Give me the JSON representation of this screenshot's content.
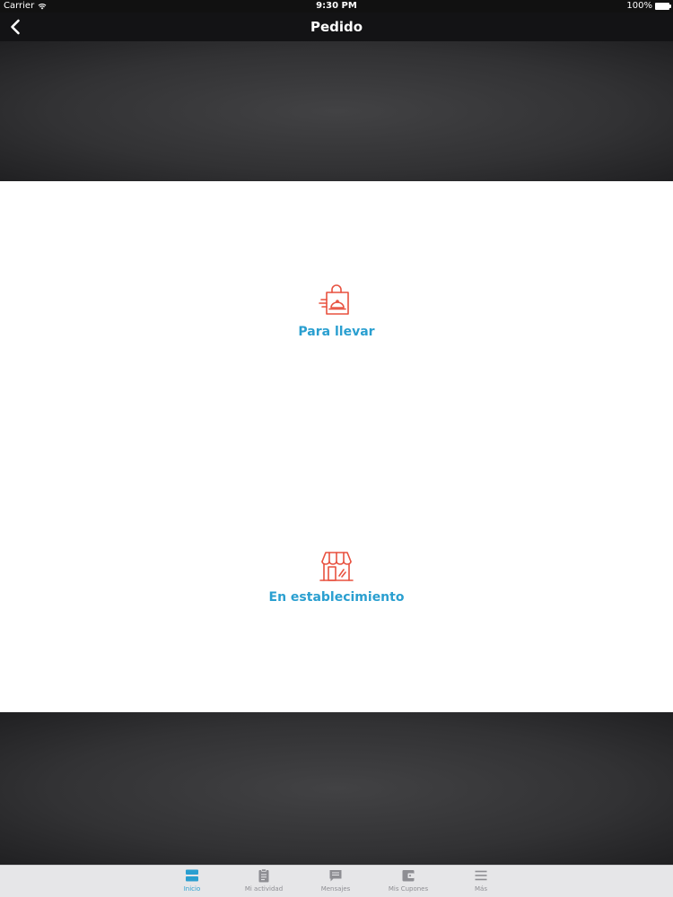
{
  "status_bar": {
    "carrier": "Carrier",
    "time": "9:30 PM",
    "battery": "100%"
  },
  "nav": {
    "title": "Pedido"
  },
  "options": {
    "takeaway_label": "Para llevar",
    "dinein_label": "En establecimiento"
  },
  "tabs": [
    {
      "label": "Inicio",
      "icon": "home-icon",
      "active": true
    },
    {
      "label": "Mi actividad",
      "icon": "clipboard-icon",
      "active": false
    },
    {
      "label": "Mensajes",
      "icon": "chat-icon",
      "active": false
    },
    {
      "label": "Mis Cupones",
      "icon": "wallet-icon",
      "active": false
    },
    {
      "label": "Más",
      "icon": "menu-icon",
      "active": false
    }
  ],
  "colors": {
    "accent": "#2a9fd0",
    "icon_red": "#e8513f",
    "tab_inactive": "#8e8e93"
  }
}
